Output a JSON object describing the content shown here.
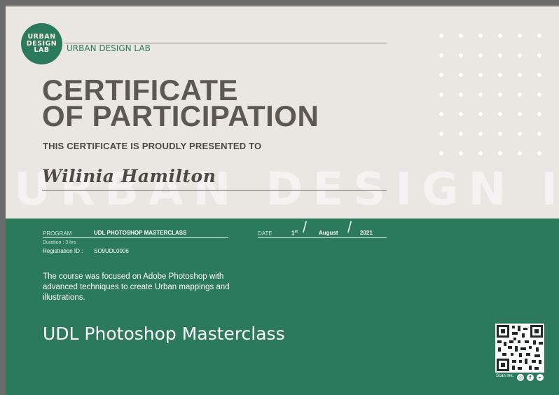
{
  "logo": {
    "line1": "URBAN",
    "line2": "DESIGN",
    "line3": "LAB"
  },
  "org_name": "URBAN DESIGN LAB",
  "title": {
    "line1": "CERTIFICATE",
    "line2": "OF PARTICIPATION"
  },
  "subtitle": "THIS CERTIFICATE IS PROUDLY PRESENTED TO",
  "watermark": "URBAN DESIGN LAB",
  "recipient": "Wilinia Hamilton",
  "program": {
    "label": "PROGRAM",
    "value": "UDL PHOTOSHOP MASTERCLASS"
  },
  "duration": "Duration : 3 hrs",
  "registration": {
    "label": "Registration ID :",
    "value": "SO9UDL0006"
  },
  "date": {
    "label": "DATE",
    "day": "1",
    "day_suffix": "st",
    "month": "August",
    "year": "2021"
  },
  "description": "The course was focused on Adobe Photoshop with advanced techniques  to create Urban mappings and illustrations.",
  "course_title": "UDL Photoshop Masterclass",
  "scan_label": "Scan me.",
  "colors": {
    "green": "#2c7a5c",
    "beige": "#eae6e1",
    "title_gray": "#5e5853"
  },
  "icons": [
    "qr-code-icon",
    "instagram-icon",
    "facebook-icon",
    "youtube-icon"
  ]
}
